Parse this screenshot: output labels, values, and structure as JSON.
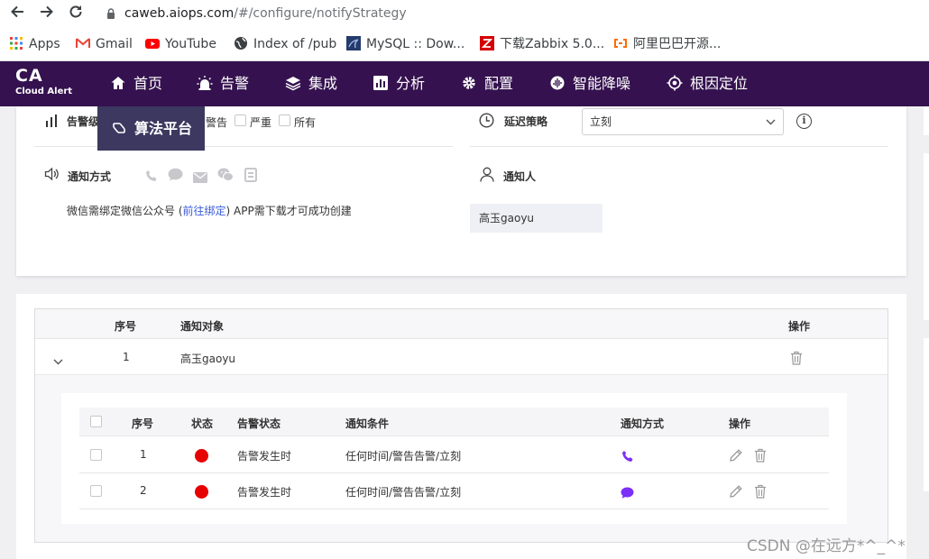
{
  "browser": {
    "url_host": "caweb.aiops.com",
    "url_path": "/#/configure/notifyStrategy",
    "bookmarks": [
      {
        "label": "Apps",
        "icon": "apps-grid-icon"
      },
      {
        "label": "Gmail",
        "icon": "gmail-icon"
      },
      {
        "label": "YouTube",
        "icon": "youtube-icon"
      },
      {
        "label": "Index of /pub",
        "icon": "globe-icon"
      },
      {
        "label": "MySQL :: Dow...",
        "icon": "mysql-icon"
      },
      {
        "label": "下载Zabbix 5.0...",
        "icon": "zabbix-icon"
      },
      {
        "label": "阿里巴巴开源...",
        "icon": "alibaba-icon"
      }
    ]
  },
  "app": {
    "logo_title": "CA",
    "logo_subtitle": "Cloud Alert",
    "menu": [
      {
        "label": "首页",
        "icon": "home-icon"
      },
      {
        "label": "告警",
        "icon": "alarm-icon"
      },
      {
        "label": "集成",
        "icon": "layers-icon"
      },
      {
        "label": "分析",
        "icon": "chart-icon"
      },
      {
        "label": "配置",
        "icon": "gear-icon"
      },
      {
        "label": "智能降噪",
        "icon": "noise-icon"
      },
      {
        "label": "根因定位",
        "icon": "target-icon"
      }
    ],
    "algo_platform": "算法平台",
    "brand_color": "#35124f"
  },
  "form": {
    "alert_level_label": "告警级",
    "levels": [
      "警告",
      "严重",
      "所有"
    ],
    "delay_label": "延迟策略",
    "delay_value": "立刻",
    "notify_method_label": "通知方式",
    "notify_person_label": "通知人",
    "wechat_note_prefix": "微信需绑定微信公众号 (",
    "wechat_note_link": "前往绑定",
    "wechat_note_suffix": ") APP需下载才可成功创建",
    "person_value": "高玉gaoyu"
  },
  "outer_table": {
    "headers": {
      "index": "序号",
      "target": "通知对象",
      "action": "操作"
    },
    "rows": [
      {
        "index": "1",
        "target": "高玉gaoyu"
      }
    ]
  },
  "inner_table": {
    "headers": {
      "index": "序号",
      "status": "状态",
      "alert_state": "告警状态",
      "condition": "通知条件",
      "method": "通知方式",
      "action": "操作"
    },
    "rows": [
      {
        "index": "1",
        "status_color": "#e60000",
        "alert_state": "告警发生时",
        "condition": "任何时间/警告告警/立刻",
        "method_icon": "phone-icon"
      },
      {
        "index": "2",
        "status_color": "#e60000",
        "alert_state": "告警发生时",
        "condition": "任何时间/警告告警/立刻",
        "method_icon": "chat-bubble-icon"
      }
    ]
  },
  "watermark": "CSDN @在远方*^_^*"
}
